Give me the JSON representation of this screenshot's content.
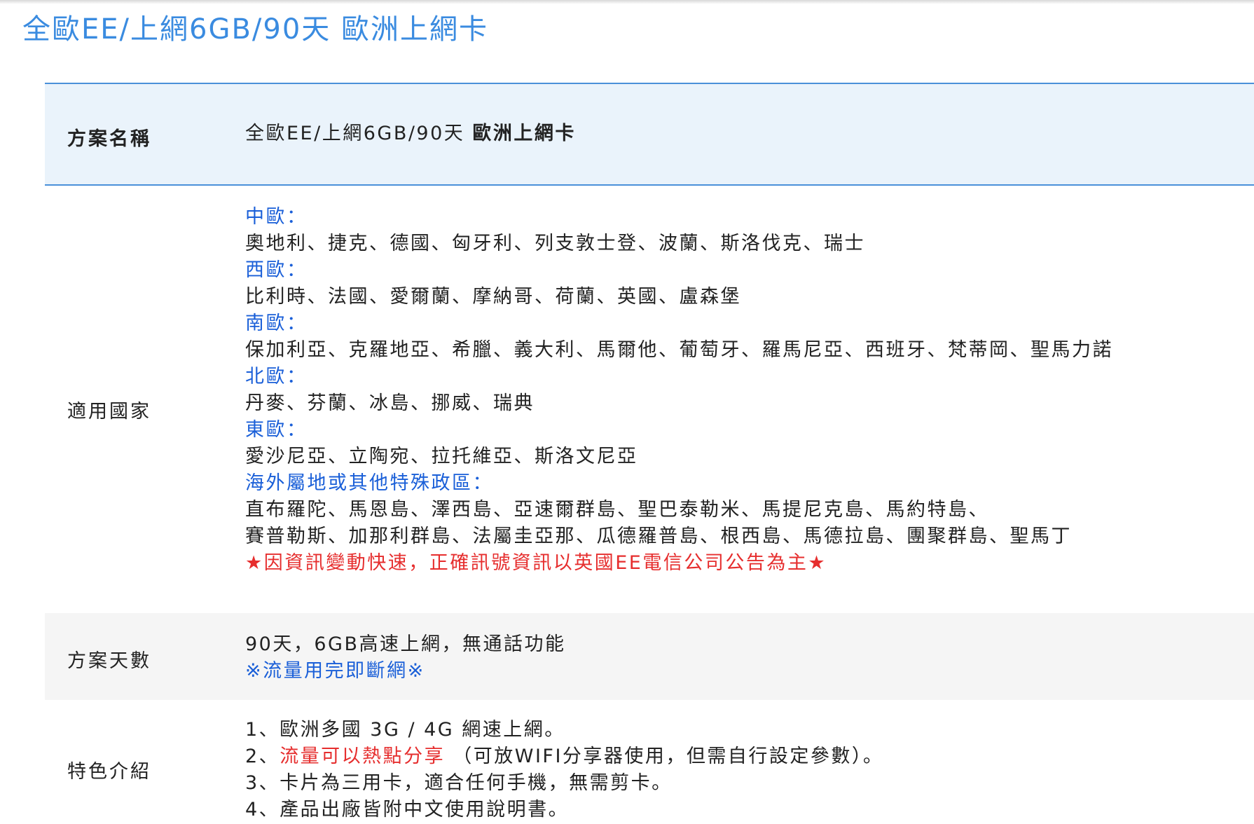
{
  "page": {
    "title": "全歐EE/上網6GB/90天 歐洲上網卡"
  },
  "spec": {
    "plan_name": {
      "label": "方案名稱",
      "value_prefix": "全歐EE/上網6GB/90天",
      "value_bold": "歐洲上網卡"
    },
    "countries": {
      "label": "適用國家",
      "central_heading": "中歐：",
      "central_list": "奧地利、捷克、德國、匈牙利、列支敦士登、波蘭、斯洛伐克、瑞士",
      "western_heading": "西歐：",
      "western_list": "比利時、法國、愛爾蘭、摩納哥、荷蘭、英國、盧森堡",
      "southern_heading": "南歐：",
      "southern_list": "保加利亞、克羅地亞、希臘、義大利、馬爾他、葡萄牙、羅馬尼亞、西班牙、梵蒂岡、聖馬力諾",
      "northern_heading": "北歐：",
      "northern_list": "丹麥、芬蘭、冰島、挪威、瑞典",
      "eastern_heading": "東歐：",
      "eastern_list": "愛沙尼亞、立陶宛、拉托維亞、斯洛文尼亞",
      "overseas_heading": "海外屬地或其他特殊政區：",
      "overseas_list_1": "直布羅陀、馬恩島、澤西島、亞速爾群島、聖巴泰勒米、馬提尼克島、馬約特島、",
      "overseas_list_2": "賽普勒斯、加那利群島、法屬圭亞那、瓜德羅普島、根西島、馬德拉島、團聚群島、聖馬丁",
      "notice": "★因資訊變動快速，正確訊號資訊以英國EE電信公司公告為主★"
    },
    "days": {
      "label": "方案天數",
      "line_1": "90天，6GB高速上網，無通話功能",
      "line_2": "※流量用完即斷網※"
    },
    "features": {
      "label": "特色介紹",
      "item_1": "1、歐洲多國 3G / 4G 網速上網。",
      "item_2_prefix": "2、",
      "item_2_highlight": "流量可以熱點分享",
      "item_2_suffix": " （可放WIFI分享器使用，但需自行設定參數）。",
      "item_3": "3、卡片為三用卡，適合任何手機，無需剪卡。",
      "item_4": "4、產品出廠皆附中文使用說明書。"
    }
  },
  "colors": {
    "title_blue": "#3a8be0",
    "heading_blue": "#1a5fd8",
    "notice_red": "#e62e2e",
    "header_row_bg": "#eaf3fb",
    "alt_row_bg": "#f5f5f5"
  }
}
